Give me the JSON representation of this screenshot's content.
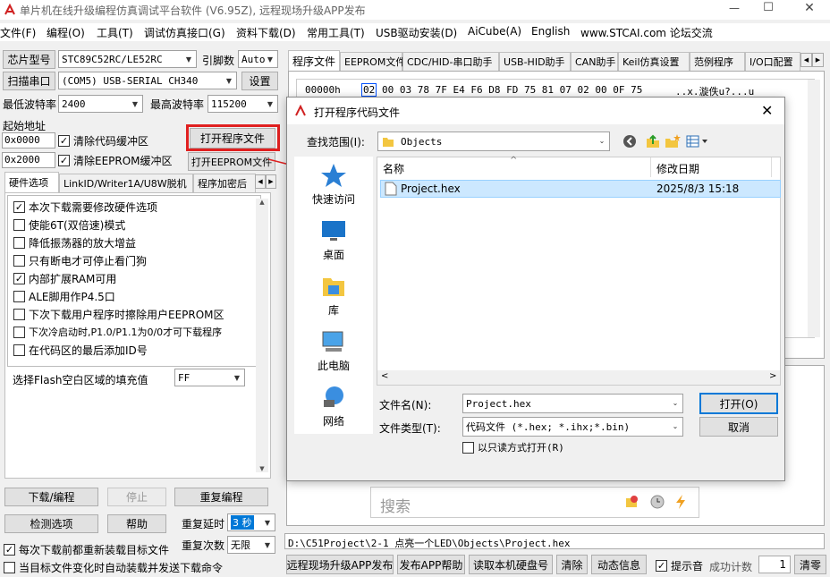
{
  "window": {
    "title": "单片机在线升级编程仿真调试平台软件 (V6.95Z), 远程现场升级APP发布",
    "controls": [
      "—",
      "☐",
      "✕"
    ]
  },
  "menu": [
    "文件(F)",
    "编程(O)",
    "工具(T)",
    "调试仿真接口(G)",
    "资料下载(D)",
    "常用工具(T)",
    "USB驱动安装(D)",
    "AiCube(A)",
    "English",
    "www.STCAI.com 论坛交流"
  ],
  "left": {
    "chip_label": "芯片型号",
    "chip_value": "STC89C52RC/LE52RC",
    "pin_label": "引脚数",
    "pin_value": "Auto",
    "scan_label": "扫描串口",
    "port_value": "(COM5) USB-SERIAL CH340",
    "settings_label": "设置",
    "min_baud_label": "最低波特率",
    "min_baud_value": "2400",
    "max_baud_label": "最高波特率",
    "max_baud_value": "115200",
    "start_addr_label": "起始地址",
    "addr1": "0x0000",
    "clear_code_label": "清除代码缓冲区",
    "addr2": "0x2000",
    "clear_eeprom_label": "清除EEPROM缓冲区",
    "open_prog_label": "打开程序文件",
    "open_eeprom_label": "打开EEPROM文件",
    "tabs": [
      "硬件选项",
      "LinkID/Writer1A/U8W脱机",
      "程序加密后"
    ],
    "options": [
      {
        "label": "本次下载需要修改硬件选项",
        "checked": "✓"
      },
      {
        "label": "使能6T(双倍速)模式",
        "checked": ""
      },
      {
        "label": "降低振荡器的放大增益",
        "checked": ""
      },
      {
        "label": "只有断电才可停止看门狗",
        "checked": ""
      },
      {
        "label": "内部扩展RAM可用",
        "checked": "✓"
      },
      {
        "label": "ALE脚用作P4.5口",
        "checked": ""
      },
      {
        "label": "下次下载用户程序时擦除用户EEPROM区",
        "checked": ""
      },
      {
        "label": "下次冷启动时,P1.0/P1.1为0/0才可下载程序",
        "checked": ""
      },
      {
        "label": "在代码区的最后添加ID号",
        "checked": ""
      }
    ],
    "fill_label": "选择Flash空白区域的填充值",
    "fill_value": "FF",
    "download_label": "下载/编程",
    "stop_label": "停止",
    "reprogram_label": "重复编程",
    "detect_label": "检测选项",
    "help_label": "帮助",
    "delay_label": "重复延时",
    "delay_value": "3 秒",
    "count_label": "重复次数",
    "count_value": "无限",
    "reload_label": "每次下载前都重新装载目标文件",
    "reload_checked": "✓",
    "auto_label": "当目标文件变化时自动装载并发送下载命令"
  },
  "right": {
    "tabs": [
      "程序文件",
      "EEPROM文件",
      "CDC/HID-串口助手",
      "USB-HID助手",
      "CAN助手",
      "Keil仿真设置",
      "范例程序",
      "I/O口配置"
    ],
    "hex": {
      "addr": "00000h",
      "first_byte": "02",
      "bytes": "00 03 78 7F E4 F6 D8 FD 75 81 07 02 00 0F 75",
      "ascii": "..x.漩佚u?...u"
    },
    "search_placeholder": "搜索",
    "path": "D:\\C51Project\\2-1 点亮一个LED\\Objects\\Project.hex",
    "bottom_buttons": [
      "远程现场升级APP发布",
      "发布APP帮助",
      "读取本机硬盘号",
      "清除",
      "动态信息"
    ],
    "beep_label": "提示音",
    "beep_checked": "✓",
    "success_label": "成功计数",
    "success_value": "1",
    "clear_label": "清零"
  },
  "dialog": {
    "title": "打开程序代码文件",
    "lookin_label": "查找范围(I):",
    "lookin_value": "Objects",
    "sidebar": [
      "快速访问",
      "桌面",
      "库",
      "此电脑",
      "网络"
    ],
    "col_name": "名称",
    "col_date": "修改日期",
    "file_name": "Project.hex",
    "file_date": "2025/8/3 15:18",
    "filename_label": "文件名(N):",
    "filename_value": "Project.hex",
    "filetype_label": "文件类型(T):",
    "filetype_value": "代码文件 (*.hex; *.ihx;*.bin)",
    "readonly_label": "以只读方式打开(R)",
    "open_label": "打开(O)",
    "cancel_label": "取消",
    "close": "✕"
  },
  "colors": {
    "highlight_red": "#e02020",
    "selection_blue": "#cce8ff",
    "button_blue_border": "#0078d7",
    "folder_yellow": "#f3c640"
  }
}
